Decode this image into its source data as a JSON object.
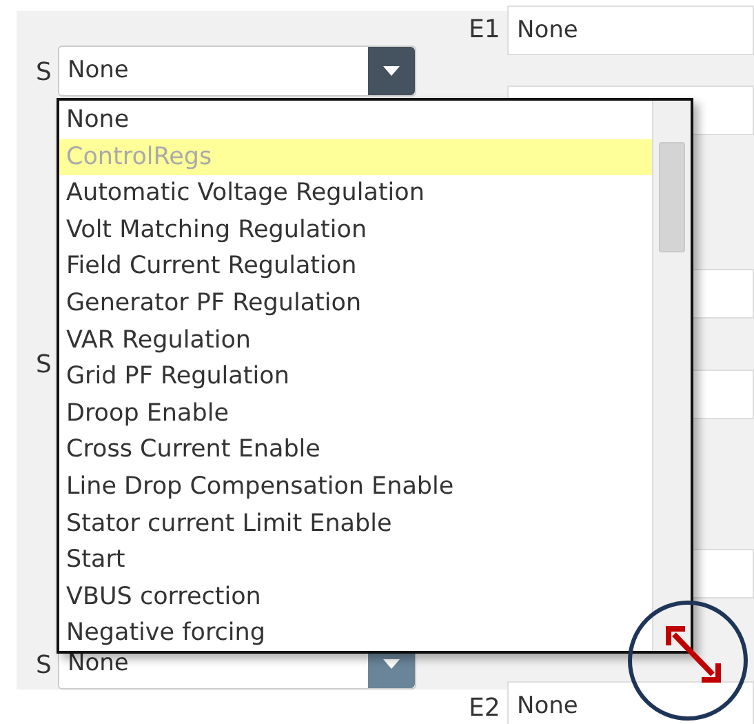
{
  "top_field": {
    "label": "E1",
    "value": "None"
  },
  "selects": [
    {
      "label": "S",
      "value": "None"
    },
    {
      "label": "S"
    },
    {
      "label": "S",
      "value": "None"
    }
  ],
  "dropdown": {
    "items": [
      {
        "label": "None",
        "selected": false,
        "disabled": false
      },
      {
        "label": "ControlRegs",
        "selected": true,
        "disabled": true
      },
      {
        "label": "Automatic Voltage Regulation",
        "selected": false,
        "disabled": false
      },
      {
        "label": "Volt Matching Regulation",
        "selected": false,
        "disabled": false
      },
      {
        "label": "Field Current Regulation",
        "selected": false,
        "disabled": false
      },
      {
        "label": "Generator PF Regulation",
        "selected": false,
        "disabled": false
      },
      {
        "label": "VAR Regulation",
        "selected": false,
        "disabled": false
      },
      {
        "label": "Grid PF Regulation",
        "selected": false,
        "disabled": false
      },
      {
        "label": "Droop Enable",
        "selected": false,
        "disabled": false
      },
      {
        "label": "Cross Current Enable",
        "selected": false,
        "disabled": false
      },
      {
        "label": "Line Drop Compensation Enable",
        "selected": false,
        "disabled": false
      },
      {
        "label": "Stator current Limit Enable",
        "selected": false,
        "disabled": false
      },
      {
        "label": "Start",
        "selected": false,
        "disabled": false
      },
      {
        "label": "VBUS correction",
        "selected": false,
        "disabled": false
      },
      {
        "label": "Negative forcing",
        "selected": false,
        "disabled": false
      }
    ]
  },
  "bottom_field": {
    "label": "E2",
    "value": "None"
  }
}
